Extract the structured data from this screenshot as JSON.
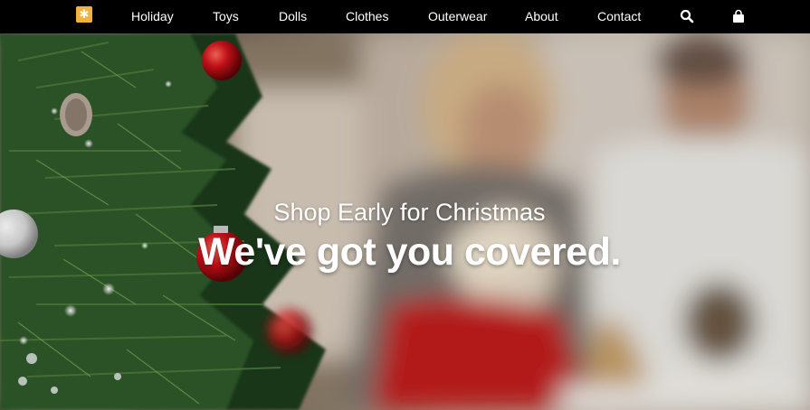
{
  "navbar": {
    "logo_icon": "star-logo-icon",
    "logo_color": "#f2b33d",
    "links": [
      "Holiday",
      "Toys",
      "Dolls",
      "Clothes",
      "Outerwear",
      "About",
      "Contact"
    ],
    "icons": [
      "search-icon",
      "shopping-bag-icon"
    ]
  },
  "hero": {
    "subtitle": "Shop Early for Christmas",
    "title": "We've got you covered."
  }
}
